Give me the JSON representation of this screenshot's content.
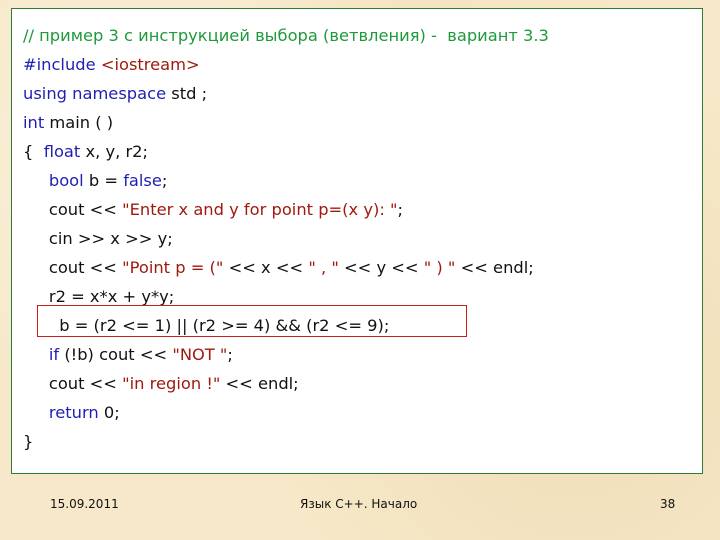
{
  "code_lines": [
    [
      {
        "t": "// пример 3 с инструкцией выбора (ветвления) -  вариант 3.3",
        "c": "c"
      }
    ],
    [
      {
        "t": "#include ",
        "c": "k"
      },
      {
        "t": "<iostream>",
        "c": "s"
      }
    ],
    [
      {
        "t": "using namespace",
        "c": "k"
      },
      {
        "t": " std ;",
        "c": ""
      }
    ],
    [
      {
        "t": "int",
        "c": "k"
      },
      {
        "t": " main ( )",
        "c": ""
      }
    ],
    [
      {
        "t": "{  ",
        "c": ""
      },
      {
        "t": "float",
        "c": "k"
      },
      {
        "t": " x, y, r2;",
        "c": ""
      }
    ],
    [
      {
        "t": "     ",
        "c": ""
      },
      {
        "t": "bool",
        "c": "k"
      },
      {
        "t": " b = ",
        "c": ""
      },
      {
        "t": "false",
        "c": "k"
      },
      {
        "t": ";",
        "c": ""
      }
    ],
    [
      {
        "t": "     cout << ",
        "c": ""
      },
      {
        "t": "\"Enter x and y for point p=(x y): \"",
        "c": "s"
      },
      {
        "t": ";",
        "c": ""
      }
    ],
    [
      {
        "t": "     cin >> x >> y;",
        "c": ""
      }
    ],
    [
      {
        "t": "     cout << ",
        "c": ""
      },
      {
        "t": "\"Point p = (\"",
        "c": "s"
      },
      {
        "t": " << x << ",
        "c": ""
      },
      {
        "t": "\" , \"",
        "c": "s"
      },
      {
        "t": " << y << ",
        "c": ""
      },
      {
        "t": "\" ) \"",
        "c": "s"
      },
      {
        "t": " << endl;",
        "c": ""
      }
    ],
    [
      {
        "t": "     r2 = x*x + y*y;",
        "c": ""
      }
    ],
    [
      {
        "t": "       b = (r2 <= 1) || (r2 >= 4) && (r2 <= 9);",
        "c": ""
      }
    ],
    [
      {
        "t": "     ",
        "c": ""
      },
      {
        "t": "if",
        "c": "k"
      },
      {
        "t": " (!b) cout << ",
        "c": ""
      },
      {
        "t": "\"NOT \"",
        "c": "s"
      },
      {
        "t": ";",
        "c": ""
      }
    ],
    [
      {
        "t": "     cout << ",
        "c": ""
      },
      {
        "t": "\"in region !\"",
        "c": "s"
      },
      {
        "t": " << endl;",
        "c": ""
      }
    ],
    [
      {
        "t": "     ",
        "c": ""
      },
      {
        "t": "return",
        "c": "k"
      },
      {
        "t": " 0;",
        "c": ""
      }
    ],
    [
      {
        "t": "}",
        "c": ""
      }
    ]
  ],
  "footer": {
    "date": "15.09.2011",
    "title": "Язык С++. Начало",
    "page": "38"
  },
  "colors": {
    "comment": "#1e9a3a",
    "keyword": "#1f1fb4",
    "string": "#a0190f",
    "highlight_border": "#c8201c"
  }
}
